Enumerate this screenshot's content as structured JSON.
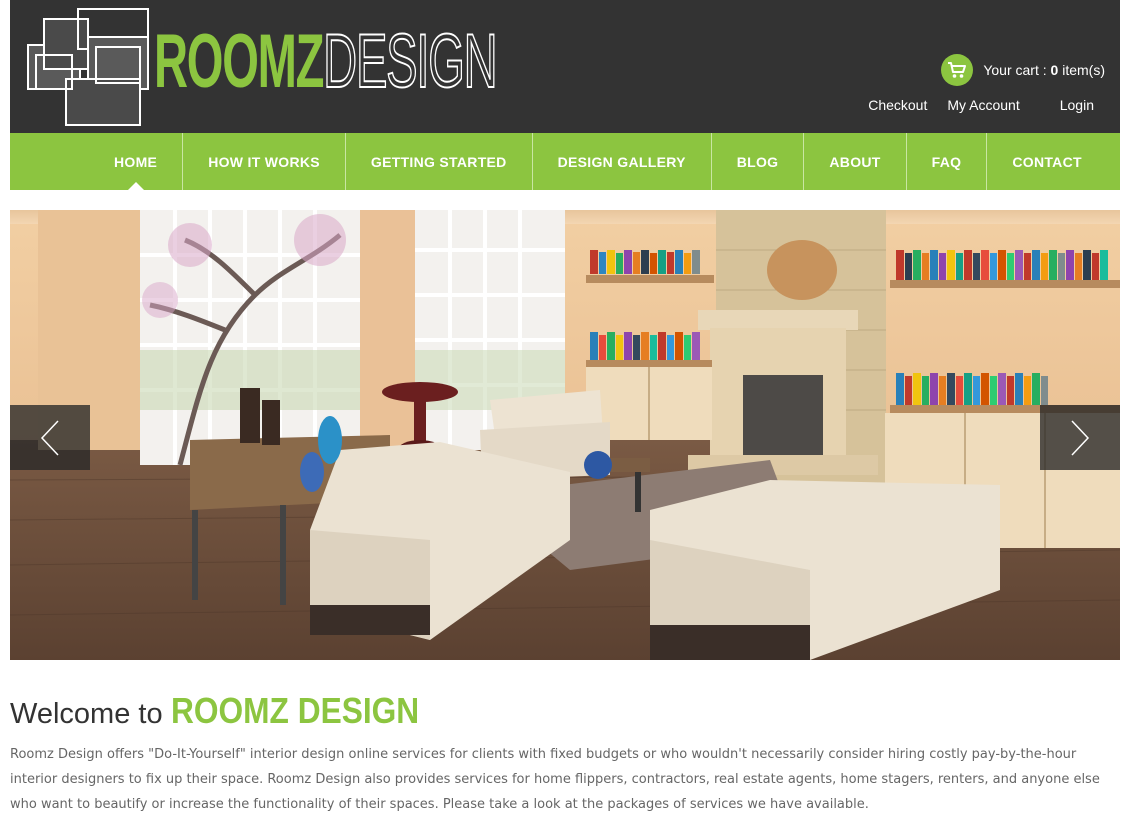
{
  "brand": {
    "name_part1": "ROOMZ",
    "name_part2": "DESIGN"
  },
  "cart": {
    "prefix": "Your cart : ",
    "count": "0",
    "suffix": " item(s)"
  },
  "account_links": {
    "checkout": "Checkout",
    "my_account": "My Account",
    "login": "Login"
  },
  "nav": {
    "items": [
      {
        "label": "HOME",
        "active": true
      },
      {
        "label": "HOW IT WORKS"
      },
      {
        "label": "GETTING STARTED"
      },
      {
        "label": "DESIGN GALLERY"
      },
      {
        "label": "BLOG"
      },
      {
        "label": "ABOUT"
      },
      {
        "label": "FAQ"
      },
      {
        "label": "CONTACT"
      }
    ]
  },
  "welcome": {
    "prefix": "Welcome to",
    "brand": "ROOMZ DESIGN"
  },
  "intro_text": "Roomz Design offers \"Do-It-Yourself\" interior design online services for clients with fixed budgets or who wouldn't necessarily consider hiring costly pay-by-the-hour interior designers to fix up their space. Roomz Design also provides services for home flippers, contractors, real estate agents, home stagers, renters, and anyone else who want to beautify or increase the functionality of their spaces. Please take a look at the packages of services we have available.",
  "colors": {
    "accent": "#8cc540",
    "header_bg": "#333333",
    "text": "#666666"
  },
  "icons": {
    "cart": "shopping-cart-icon",
    "prev": "chevron-left-icon",
    "next": "chevron-right-icon"
  }
}
